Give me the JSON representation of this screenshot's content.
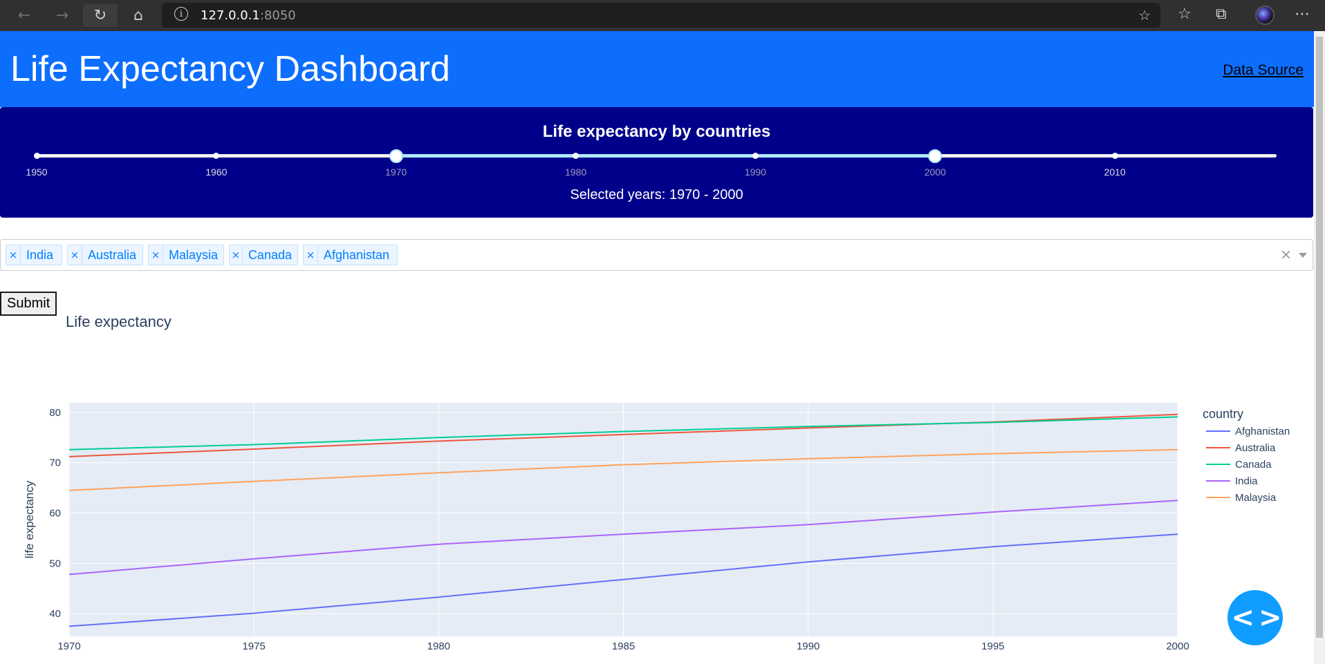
{
  "browser": {
    "url_host": "127.0.0.1",
    "url_port": ":8050",
    "icons": [
      "back-icon",
      "forward-icon",
      "reload-icon",
      "home-icon",
      "info-icon",
      "add-favorite-icon",
      "favorites-icon",
      "collections-icon",
      "profile-avatar",
      "more-icon"
    ]
  },
  "header": {
    "title": "Life Expectancy Dashboard",
    "link": "Data Source",
    "bg_color": "#0d6efd"
  },
  "slider": {
    "title": "Life expectancy by countries",
    "marks": [
      "1950",
      "1960",
      "1970",
      "1980",
      "1990",
      "2000",
      "2010"
    ],
    "range": [
      1970,
      2000
    ],
    "caption": "Selected years: 1970 - 2000",
    "bg_color": "#00008b"
  },
  "dropdown": {
    "selected": [
      "India",
      "Australia",
      "Malaysia",
      "Canada",
      "Afghanistan"
    ],
    "remove_symbol": "×",
    "clear_symbol": "×"
  },
  "submit": {
    "label": "Submit"
  },
  "chart_data": {
    "type": "line",
    "title": "Life expectancy",
    "xlabel": "",
    "ylabel": "life expectancy",
    "legend_title": "country",
    "legend_position": "right",
    "grid": true,
    "xlim": [
      1970,
      2000
    ],
    "ylim": [
      35.5,
      81.9
    ],
    "x_ticks": [
      1970,
      1975,
      1980,
      1985,
      1990,
      1995,
      2000
    ],
    "y_ticks": [
      40,
      50,
      60,
      70,
      80
    ],
    "series": [
      {
        "name": "Afghanistan",
        "color": "#636efa",
        "points": [
          [
            1970,
            37.5
          ],
          [
            1975,
            40.1
          ],
          [
            1980,
            43.3
          ],
          [
            1985,
            46.8
          ],
          [
            1990,
            50.3
          ],
          [
            1995,
            53.3
          ],
          [
            2000,
            55.8
          ]
        ]
      },
      {
        "name": "Australia",
        "color": "#ef553b",
        "points": [
          [
            1970,
            71.2
          ],
          [
            1975,
            72.7
          ],
          [
            1980,
            74.3
          ],
          [
            1985,
            75.6
          ],
          [
            1990,
            76.9
          ],
          [
            1995,
            78.1
          ],
          [
            2000,
            79.6
          ]
        ]
      },
      {
        "name": "Canada",
        "color": "#00cc96",
        "points": [
          [
            1970,
            72.6
          ],
          [
            1975,
            73.6
          ],
          [
            1980,
            75.0
          ],
          [
            1985,
            76.2
          ],
          [
            1990,
            77.2
          ],
          [
            1995,
            78.0
          ],
          [
            2000,
            79.1
          ]
        ]
      },
      {
        "name": "India",
        "color": "#ab63fa",
        "points": [
          [
            1970,
            47.8
          ],
          [
            1975,
            50.9
          ],
          [
            1980,
            53.8
          ],
          [
            1985,
            55.8
          ],
          [
            1990,
            57.7
          ],
          [
            1995,
            60.2
          ],
          [
            2000,
            62.5
          ]
        ]
      },
      {
        "name": "Malaysia",
        "color": "#ffa15a",
        "points": [
          [
            1970,
            64.5
          ],
          [
            1975,
            66.3
          ],
          [
            1980,
            68.0
          ],
          [
            1985,
            69.6
          ],
          [
            1990,
            70.8
          ],
          [
            1995,
            71.8
          ],
          [
            2000,
            72.6
          ]
        ]
      }
    ]
  },
  "fab": {
    "symbol": "< >",
    "color": "#119dff"
  }
}
